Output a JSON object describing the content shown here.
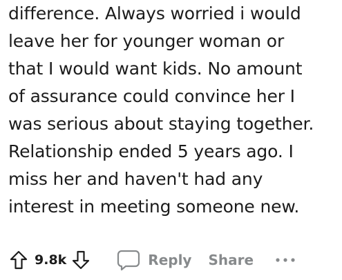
{
  "comment": {
    "lines": [
      "difference. Always worried i would",
      "leave her for younger woman or",
      "that I would want kids. No amount",
      "of assurance could convince her I",
      "was serious about staying together.",
      "Relationship ended 5 years ago. I",
      "miss her and haven't had any",
      "interest in meeting someone new."
    ]
  },
  "actions": {
    "vote_count": "9.8k",
    "reply_label": "Reply",
    "share_label": "Share",
    "more_icon": "ellipsis-icon",
    "upvote_icon": "arrow-up-icon",
    "downvote_icon": "arrow-down-icon",
    "reply_icon": "speech-bubble-icon"
  },
  "colors": {
    "text": "#1c1c1c",
    "muted": "#878a8c"
  }
}
